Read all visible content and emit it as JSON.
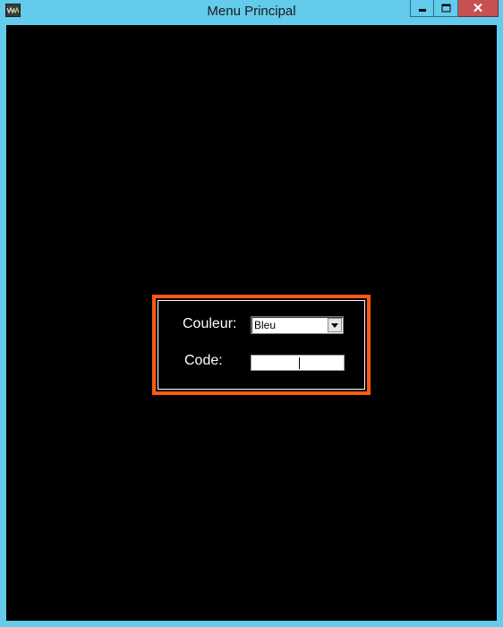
{
  "window": {
    "title": "Menu Principal",
    "close_glyph": "✕"
  },
  "icons": {
    "app": "app-icon",
    "minimize": "minimize-icon",
    "maximize": "maximize-icon",
    "close": "close-icon",
    "dropdown": "chevron-down-icon"
  },
  "colors": {
    "titlebar": "#63cbec",
    "close_button": "#c75050",
    "client_background": "#000000",
    "form_border": "#ff5a14",
    "label_text": "#ffffff"
  },
  "form": {
    "couleur_label": "Couleur:",
    "couleur_value": "Bleu",
    "code_label": "Code:",
    "code_value": ""
  }
}
